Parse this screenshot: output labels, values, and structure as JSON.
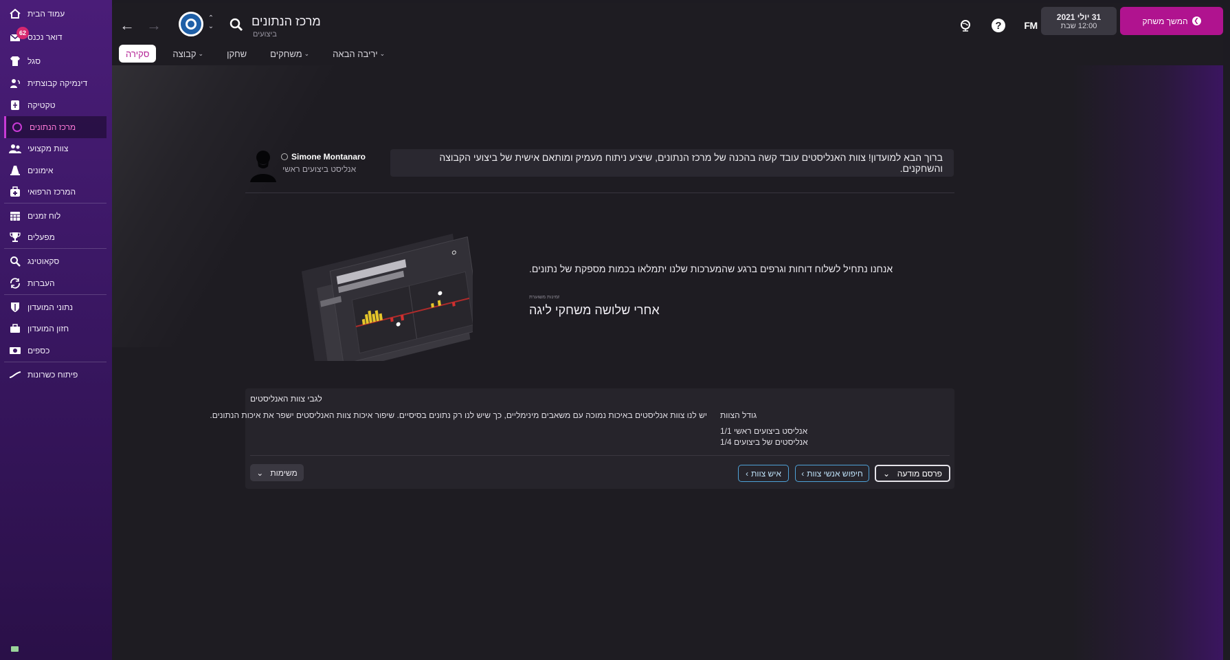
{
  "sidebar": {
    "items": [
      {
        "label": "עמוד הבית",
        "icon": "home-icon"
      },
      {
        "label": "דואר נכנס",
        "icon": "inbox-icon",
        "badge": "62"
      },
      {
        "label": "סגל",
        "icon": "shirt-icon"
      },
      {
        "label": "דינמיקה קבוצתית",
        "icon": "dynamics-icon"
      },
      {
        "label": "טקטיקה",
        "icon": "tactics-board-icon"
      },
      {
        "label": "מרכז הנתונים",
        "icon": "data-hub-icon",
        "active": true
      },
      {
        "label": "צוות מקצועי",
        "icon": "staff-icon"
      },
      {
        "label": "אימונים",
        "icon": "training-cone-icon"
      },
      {
        "label": "המרכז הרפואי",
        "icon": "medical-kit-icon"
      },
      {
        "label": "לוח זמנים",
        "icon": "calendar-icon"
      },
      {
        "label": "מפעלים",
        "icon": "trophy-icon"
      },
      {
        "label": "סקאוטינג",
        "icon": "scouting-magnifier-icon"
      },
      {
        "label": "העברות",
        "icon": "transfers-cycle-icon"
      },
      {
        "label": "נתוני המועדון",
        "icon": "club-shield-icon"
      },
      {
        "label": "חזון המועדון",
        "icon": "briefcase-icon"
      },
      {
        "label": "כספים",
        "icon": "money-icon"
      },
      {
        "label": "פיתוח כשרונות",
        "icon": "growth-chart-icon"
      }
    ]
  },
  "header": {
    "title": "מרכז הנתונים",
    "subtitle": "ביצועים",
    "date": "31 יולי 2021",
    "time": "12:00 שבת",
    "fm_logo": "FM",
    "help_icon": "?",
    "continue_label": "המשך משחק"
  },
  "tabs": [
    {
      "label": "סקירה",
      "active": true,
      "has_dropdown": false
    },
    {
      "label": "קבוצה",
      "has_dropdown": true
    },
    {
      "label": "שחקן",
      "has_dropdown": false
    },
    {
      "label": "משחקים",
      "has_dropdown": true
    },
    {
      "label": "יריבה הבאה",
      "has_dropdown": true
    }
  ],
  "analyst": {
    "name": "Simone Montanaro",
    "role": "אנליסט ביצועים ראשי",
    "message": "ברוך הבא למועדון! צוות האנליסטים עובד קשה בהכנה של מרכז הנתונים, שיציע ניתוח מעמיק ומותאם אישית של ביצועי הקבוצה והשחקנים."
  },
  "empty_state": {
    "message": "אנחנו נתחיל לשלוח דוחות וגרפים ברגע שהמערכות שלנו יתמלאו בכמות מספקת של נתונים.",
    "eta_label": "זמינות משוערת",
    "eta_value": "אחרי שלושה משחקי ליגה"
  },
  "analysts_team": {
    "title": "לגבי צוות האנליסטים",
    "description": "יש לנו צוות אנליסטים באיכות נמוכה עם משאבים מינימליים, כך שיש לנו רק נתונים בסיסיים. שיפור איכות צוות האנליסטים ישפר את איכות הנתונים.",
    "size_label": "גודל הצוות",
    "size_rows": [
      "אנליסט ביצועים ראשי 1/1",
      "אנליסטים של ביצועים 1/4"
    ],
    "tasks_button": "משימות",
    "staff_button": "איש צוות",
    "search_staff_button": "חיפוש אנשי צוות",
    "advertise_label": "פרסם מודעה"
  },
  "colors": {
    "accent": "#b0138f",
    "sidebar": "#3a1763",
    "background": "#1e1c22",
    "outline_button": "#4fa3d9"
  }
}
